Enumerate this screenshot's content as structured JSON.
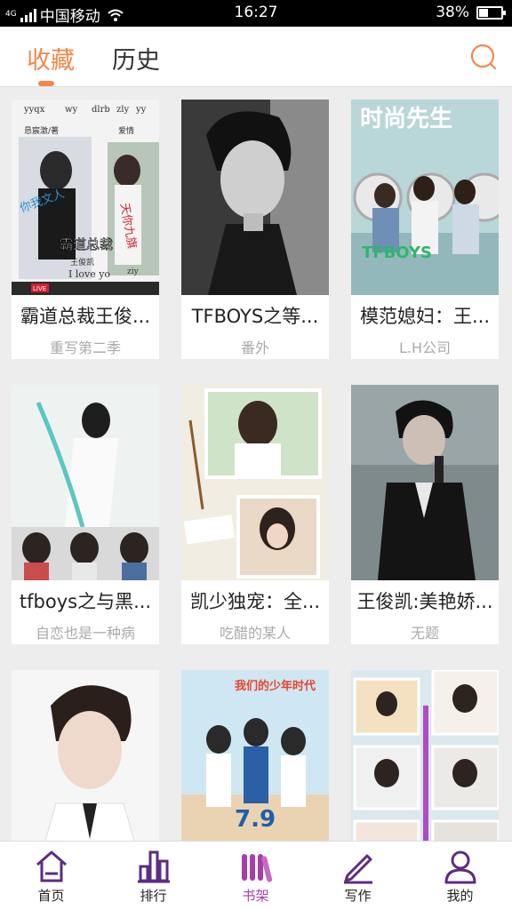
{
  "status_bar": {
    "network_label": "4G",
    "carrier": "中国移动",
    "time": "16:27",
    "battery": "38%",
    "battery_level": 0.38
  },
  "header": {
    "tabs": [
      {
        "label": "收藏",
        "active": true
      },
      {
        "label": "历史",
        "active": false
      }
    ],
    "search_icon": "search-icon",
    "accent_color": "#f0884a"
  },
  "books": [
    {
      "title": "霸道总裁王俊...",
      "author": "重写第二季",
      "cover": {
        "type": "book-cover",
        "texts": [
          "yyqx",
          "wy",
          "dlrb",
          "zly",
          "yy",
          "恳宸激/著",
          "爱情",
          "你我文人",
          "天你九旗",
          "霸道总裁",
          "王俊凯",
          "I love yo",
          "ziy",
          "LIVE"
        ]
      }
    },
    {
      "title": "TFBOYS之等...",
      "author": "番外",
      "cover": {
        "type": "bw-portrait"
      }
    },
    {
      "title": "模范媳妇：王...",
      "author": "L.H公司",
      "cover": {
        "type": "magazine",
        "texts": [
          "时尚先生",
          "TFBOYS"
        ]
      }
    },
    {
      "title": "tfboys之与黑...",
      "author": "自恋也是一种病",
      "cover": {
        "type": "collage"
      }
    },
    {
      "title": "凯少独宠：全...",
      "author": "吃醋的某人",
      "cover": {
        "type": "scrapbook"
      }
    },
    {
      "title": "王俊凯:美艳娇...",
      "author": "无题",
      "cover": {
        "type": "stage-portrait"
      }
    },
    {
      "title": "",
      "author": "",
      "cover": {
        "type": "white-portrait"
      }
    },
    {
      "title": "",
      "author": "",
      "cover": {
        "type": "poster",
        "texts": [
          "我们的少年时代",
          "7.9"
        ]
      }
    },
    {
      "title": "",
      "author": "",
      "cover": {
        "type": "photo-collage"
      }
    }
  ],
  "bottom_nav": {
    "items": [
      {
        "label": "首页",
        "icon": "home-icon",
        "active": false
      },
      {
        "label": "排行",
        "icon": "ranking-icon",
        "active": false
      },
      {
        "label": "书架",
        "icon": "bookshelf-icon",
        "active": true
      },
      {
        "label": "写作",
        "icon": "write-icon",
        "active": false
      },
      {
        "label": "我的",
        "icon": "profile-icon",
        "active": false
      }
    ],
    "active_color": "#a73ea7",
    "icon_color": "#5a2d82"
  }
}
